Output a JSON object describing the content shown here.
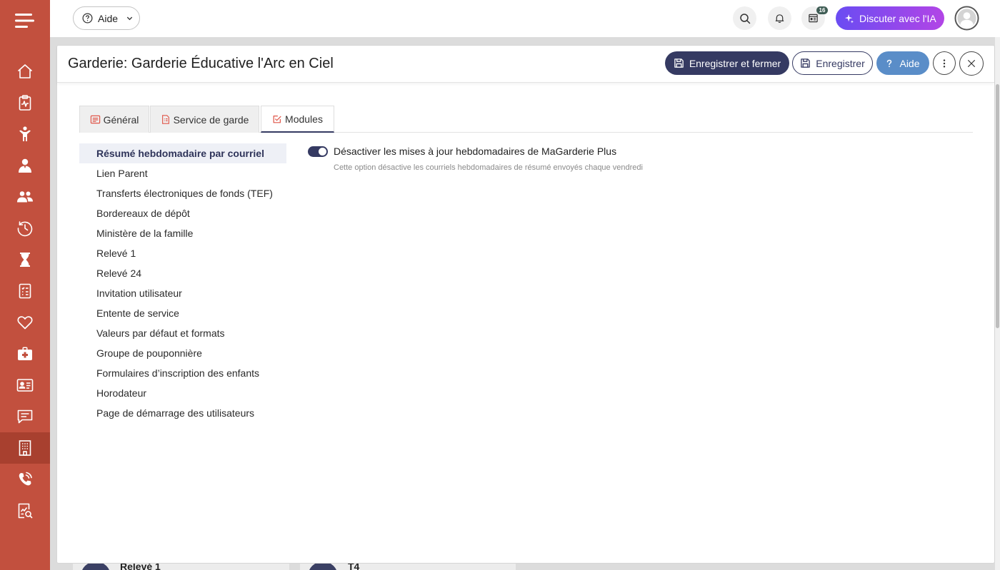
{
  "sidebar": {
    "menu_icon": "hamburger-menu-icon",
    "items": [
      {
        "icon": "home-icon"
      },
      {
        "icon": "clipboard-pulse-icon"
      },
      {
        "icon": "child-icon"
      },
      {
        "icon": "staff-icon"
      },
      {
        "icon": "group-icon"
      },
      {
        "icon": "clock-icon"
      },
      {
        "icon": "hourglass-icon"
      },
      {
        "icon": "form-checklist-icon"
      },
      {
        "icon": "heart-icon"
      },
      {
        "icon": "medical-kit-icon"
      },
      {
        "icon": "id-card-icon"
      },
      {
        "icon": "chat-icon"
      },
      {
        "icon": "building-icon",
        "active": true
      },
      {
        "icon": "phone-icon"
      },
      {
        "icon": "report-search-icon"
      }
    ]
  },
  "topbar": {
    "help": {
      "label": "Aide",
      "icon": "question-circle-icon"
    },
    "search_icon": "search-icon",
    "notifications_icon": "bell-icon",
    "news": {
      "icon": "newspaper-icon",
      "badge": "16"
    },
    "ai_button": {
      "label": "Discuter avec l'IA",
      "icon": "sparkle-icon"
    },
    "avatar_icon": "user-avatar-icon"
  },
  "dialog": {
    "title": "Garderie: Garderie Éducative l'Arc en Ciel",
    "actions": {
      "save_close": {
        "label": "Enregistrer et fermer",
        "icon": "save-icon"
      },
      "save": {
        "label": "Enregistrer",
        "icon": "save-icon"
      },
      "help": {
        "label": "Aide",
        "icon": "question-icon"
      },
      "more_icon": "kebab-menu-icon",
      "close_icon": "close-icon"
    },
    "tabs": [
      {
        "label": "Général",
        "icon": "list-icon"
      },
      {
        "label": "Service de garde",
        "icon": "document-list-icon"
      },
      {
        "label": "Modules",
        "icon": "checkbox-icon",
        "active": true
      }
    ],
    "modules": [
      {
        "label": "Résumé hebdomadaire par courriel",
        "selected": true
      },
      {
        "label": "Lien Parent"
      },
      {
        "label": "Transferts électroniques de fonds (TEF)"
      },
      {
        "label": "Bordereaux de dépôt"
      },
      {
        "label": "Ministère de la famille"
      },
      {
        "label": "Relevé 1"
      },
      {
        "label": "Relevé 24"
      },
      {
        "label": "Invitation utilisateur"
      },
      {
        "label": "Entente de service"
      },
      {
        "label": "Valeurs par défaut et formats"
      },
      {
        "label": "Groupe de pouponnière"
      },
      {
        "label": "Formulaires d’inscription des enfants"
      },
      {
        "label": "Horodateur"
      },
      {
        "label": "Page de démarrage des utilisateurs"
      }
    ],
    "setting": {
      "label": "Désactiver les mises à jour hebdomadaires de MaGarderie Plus",
      "description": "Cette option désactive les courriels hebdomadaires de résumé envoyés chaque vendredi",
      "enabled": true
    }
  },
  "background_page": {
    "cards": [
      {
        "label": "Relevé 1"
      },
      {
        "label": "T4"
      }
    ]
  },
  "colors": {
    "sidebar": "#c2503e",
    "sidebar_active": "#a8402f",
    "primary_navy": "#353a62",
    "help_button": "#5a8dc8",
    "ai_gradient_start": "#6a4cf2",
    "ai_gradient_end": "#b245e6",
    "tab_icon": "#e0574a",
    "badge": "#3f5d55",
    "selected_module_bg": "#eef0f6"
  }
}
